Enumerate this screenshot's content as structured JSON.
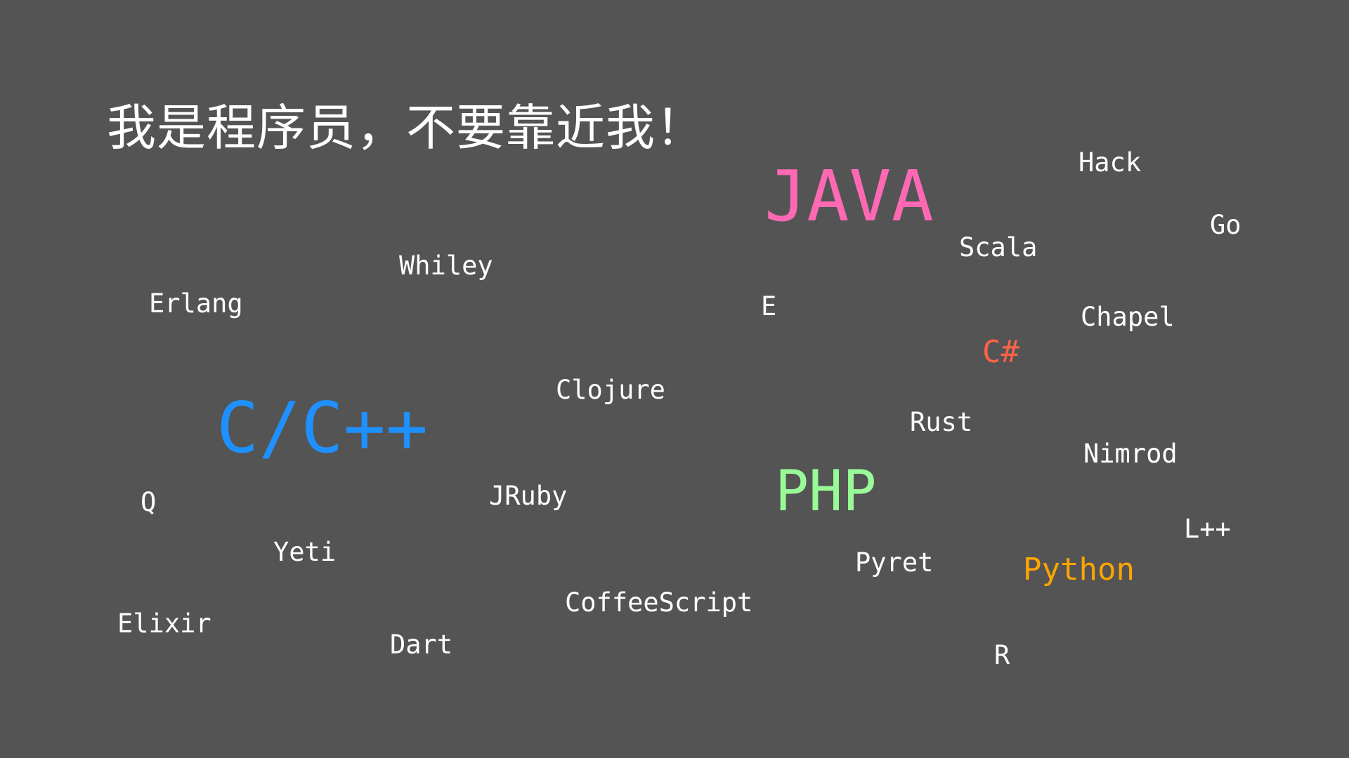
{
  "slide": {
    "title": "我是程序员，不要靠近我！"
  },
  "colors": {
    "background": "#545454",
    "text": "#ffffff",
    "java": "#ff69b4",
    "cpp": "#1e90ff",
    "php": "#98fb98",
    "python": "#ffa500",
    "csharp": "#ff6347"
  },
  "languages": {
    "java": "JAVA",
    "hack": "Hack",
    "go": "Go",
    "scala": "Scala",
    "whiley": "Whiley",
    "erlang": "Erlang",
    "e": "E",
    "chapel": "Chapel",
    "csharp": "C#",
    "clojure": "Clojure",
    "cpp": "C/C++",
    "rust": "Rust",
    "nimrod": "Nimrod",
    "q": "Q",
    "jruby": "JRuby",
    "php": "PHP",
    "lpp": "L++",
    "yeti": "Yeti",
    "pyret": "Pyret",
    "python": "Python",
    "coffeescript": "CoffeeScript",
    "elixir": "Elixir",
    "dart": "Dart",
    "r": "R"
  }
}
